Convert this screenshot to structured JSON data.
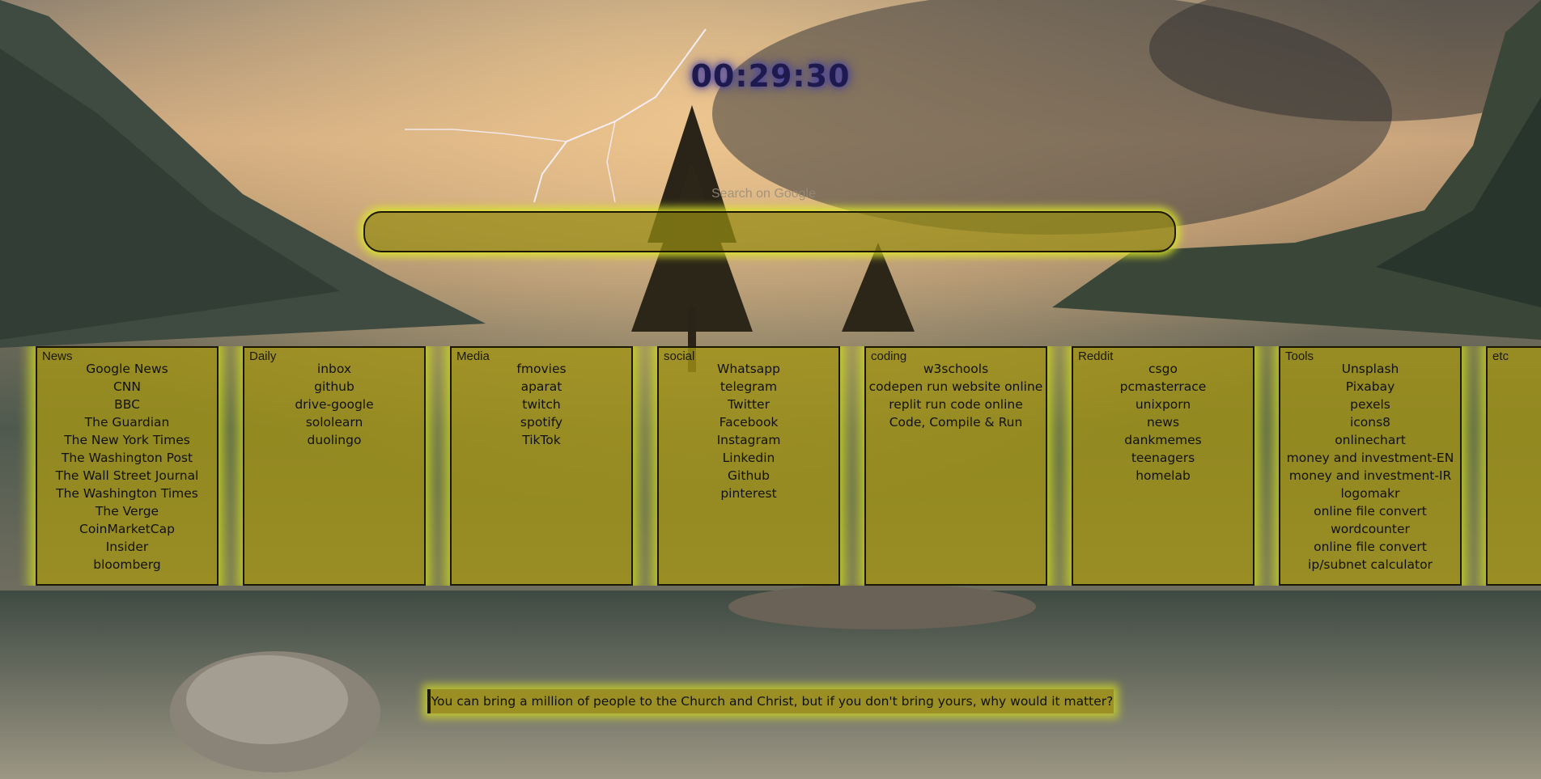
{
  "clock": {
    "time": "00:29:30"
  },
  "search": {
    "label": "Search on Google",
    "value": ""
  },
  "categories": [
    {
      "title": "News",
      "links": [
        "Google News",
        "CNN",
        "BBC",
        "The Guardian",
        "The New York Times",
        "The Washington Post",
        "The Wall Street Journal",
        "The Washington Times",
        "The Verge",
        "CoinMarketCap",
        "Insider",
        "bloomberg"
      ]
    },
    {
      "title": "Daily",
      "links": [
        "inbox",
        "github",
        "drive-google",
        "sololearn",
        "duolingo"
      ]
    },
    {
      "title": "Media",
      "links": [
        "fmovies",
        "aparat",
        "twitch",
        "spotify",
        "TikTok"
      ]
    },
    {
      "title": "social",
      "links": [
        "Whatsapp",
        "telegram",
        "Twitter",
        "Facebook",
        "Instagram",
        "Linkedin",
        "Github",
        "pinterest"
      ]
    },
    {
      "title": "coding",
      "links": [
        "w3schools",
        "codepen run website online",
        "replit run code online",
        "Code, Compile & Run"
      ]
    },
    {
      "title": "Reddit",
      "links": [
        "csgo",
        "pcmasterrace",
        "unixporn",
        "news",
        "dankmemes",
        "teenagers",
        "homelab"
      ]
    },
    {
      "title": "Tools",
      "links": [
        "Unsplash",
        "Pixabay",
        "pexels",
        "icons8",
        "onlinechart",
        "money and investment-EN",
        "money and investment-IR",
        "logomakr",
        "online file convert",
        "wordcounter",
        "online file convert",
        "ip/subnet calculator"
      ]
    },
    {
      "title": "etc",
      "links": []
    }
  ],
  "quote": {
    "text": "You can bring a million of people to the Church and Christ, but if you don't bring yours, why would it matter?"
  },
  "colors": {
    "card_bg": "#a5961a",
    "glow": "#d7e11e",
    "clock": "#1e1a4e"
  }
}
